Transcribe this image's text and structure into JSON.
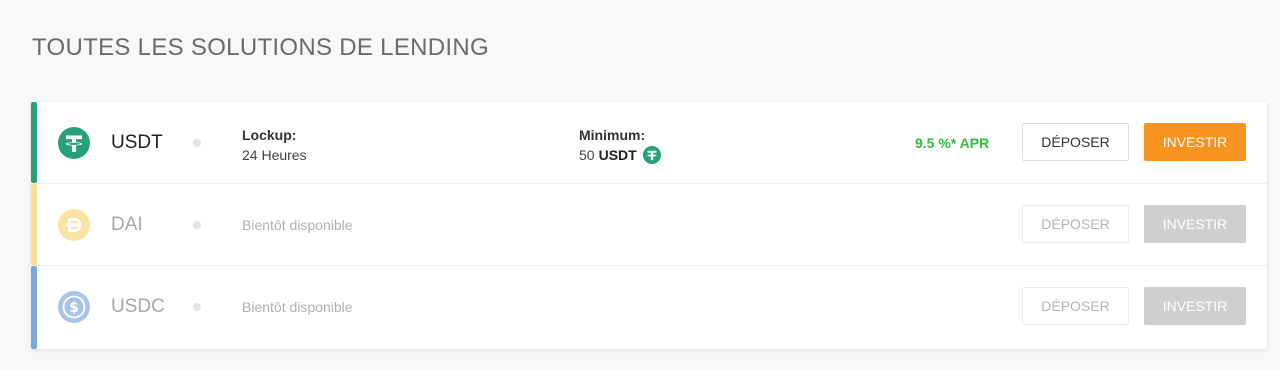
{
  "page": {
    "title": "TOUTES LES SOLUTIONS DE LENDING"
  },
  "colors": {
    "usdt_accent": "#26a17b",
    "dai_accent": "#fbdd8c",
    "usdc_accent": "#7ba7dd",
    "apr_green": "#2ebd3c",
    "invest_orange": "#f7931e",
    "disabled_gray": "#cfcfcf"
  },
  "rows": [
    {
      "coin": "USDT",
      "icon": "tether-icon",
      "lockup_label": "Lockup:",
      "lockup_value": "24 Heures",
      "minimum_label": "Minimum:",
      "minimum_amount": "50",
      "minimum_currency": "USDT",
      "apr": "9.5 %* APR",
      "deposit_label": "DÉPOSER",
      "invest_label": "INVESTIR"
    },
    {
      "coin": "DAI",
      "icon": "dai-icon",
      "status": "Bientôt disponible",
      "deposit_label": "DÉPOSER",
      "invest_label": "INVESTIR"
    },
    {
      "coin": "USDC",
      "icon": "usdc-icon",
      "status": "Bientôt disponible",
      "deposit_label": "DÉPOSER",
      "invest_label": "INVESTIR"
    }
  ]
}
